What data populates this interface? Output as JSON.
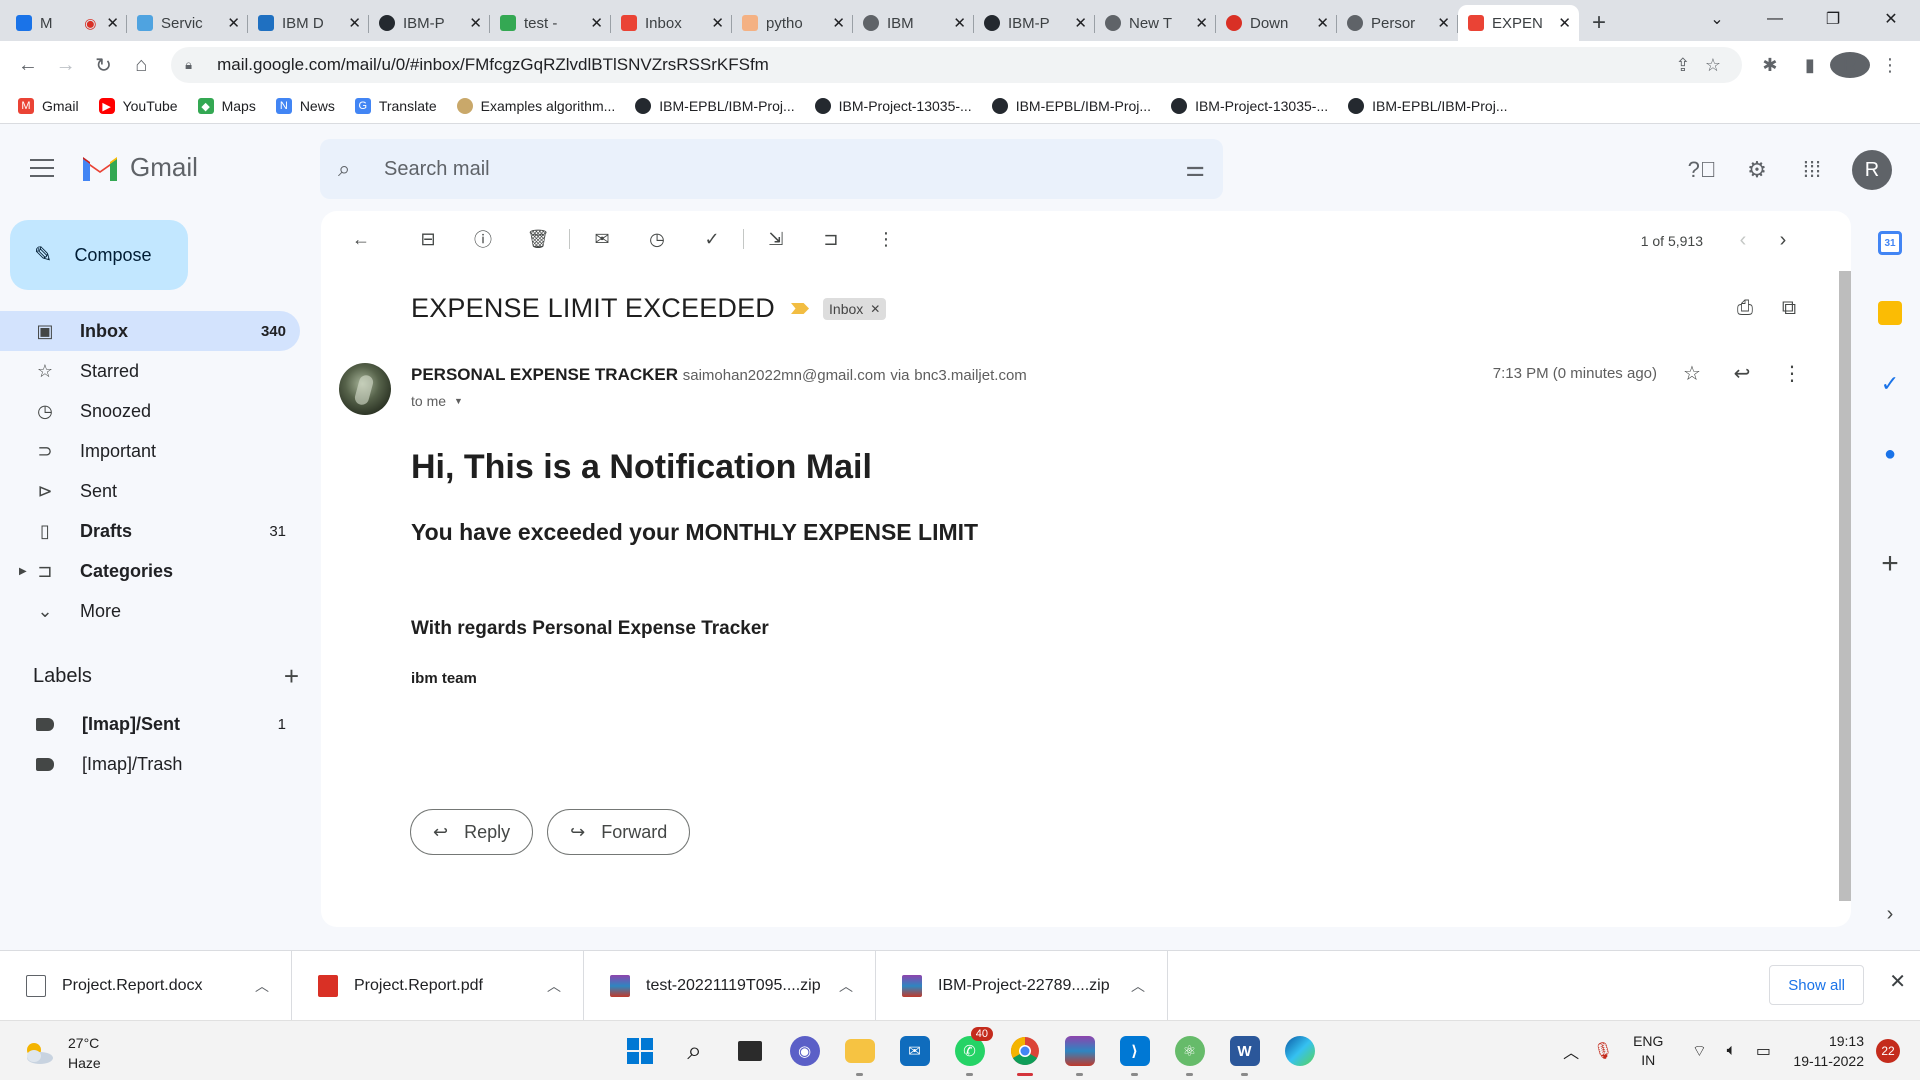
{
  "browser": {
    "tabs": [
      {
        "title": "M",
        "color": "#1a73e8"
      },
      {
        "title": "Servic",
        "color": "#4fa3e0"
      },
      {
        "title": "IBM D",
        "color": "#1f70c1"
      },
      {
        "title": "IBM-P",
        "color": "#24292f"
      },
      {
        "title": "test -",
        "color": "#34a853"
      },
      {
        "title": "Inbox",
        "color": "#ea4335"
      },
      {
        "title": "pytho",
        "color": "#f4b183"
      },
      {
        "title": "IBM",
        "color": "#5f6368"
      },
      {
        "title": "IBM-P",
        "color": "#24292f"
      },
      {
        "title": "New T",
        "color": "#5f6368"
      },
      {
        "title": "Down",
        "color": "#d93025"
      },
      {
        "title": "Persor",
        "color": "#5f6368"
      },
      {
        "title": "EXPEN",
        "color": "#ea4335"
      }
    ],
    "url": "mail.google.com/mail/u/0/#inbox/FMfcgzGqRZlvdlBTlSNVZrsRSSrKFSfm",
    "profile_initial": "R",
    "bookmarks": [
      {
        "label": "Gmail",
        "color": "#ea4335"
      },
      {
        "label": "YouTube",
        "color": "#ff0000"
      },
      {
        "label": "Maps",
        "color": "#34a853"
      },
      {
        "label": "News",
        "color": "#4285f4"
      },
      {
        "label": "Translate",
        "color": "#4285f4"
      },
      {
        "label": "Examples algorithm...",
        "color": "#c9a86a"
      },
      {
        "label": "IBM-EPBL/IBM-Proj...",
        "color": "#24292f"
      },
      {
        "label": "IBM-Project-13035-...",
        "color": "#24292f"
      },
      {
        "label": "IBM-EPBL/IBM-Proj...",
        "color": "#24292f"
      },
      {
        "label": "IBM-Project-13035-...",
        "color": "#24292f"
      },
      {
        "label": "IBM-EPBL/IBM-Proj...",
        "color": "#24292f"
      }
    ]
  },
  "gmail": {
    "brand": "Gmail",
    "search_placeholder": "Search mail",
    "avatar_initial": "R",
    "compose_label": "Compose",
    "nav": [
      {
        "label": "Inbox",
        "count": "340",
        "icon": "inbox-icon"
      },
      {
        "label": "Starred",
        "count": "",
        "icon": "star-icon"
      },
      {
        "label": "Snoozed",
        "count": "",
        "icon": "clock-icon"
      },
      {
        "label": "Important",
        "count": "",
        "icon": "important-icon"
      },
      {
        "label": "Sent",
        "count": "",
        "icon": "send-icon"
      },
      {
        "label": "Drafts",
        "count": "31",
        "icon": "draft-icon"
      },
      {
        "label": "Categories",
        "count": "",
        "icon": "label-icon"
      },
      {
        "label": "More",
        "count": "",
        "icon": "chevron-down-icon"
      }
    ],
    "labels_heading": "Labels",
    "labels": [
      {
        "label": "[Imap]/Sent",
        "count": "1"
      },
      {
        "label": "[Imap]/Trash",
        "count": ""
      }
    ],
    "pager": "1 of 5,913",
    "message": {
      "subject": "EXPENSE LIMIT EXCEEDED",
      "chip": "Inbox",
      "sender_name": "PERSONAL EXPENSE TRACKER",
      "sender_email": "saimohan2022mn@gmail.com",
      "via_word": "via",
      "via_domain": "bnc3.mailjet.com",
      "to": "to me",
      "time": "7:13 PM (0 minutes ago)",
      "heading": "Hi, This is a Notification Mail",
      "line1": "You have exceeded your MONTHLY EXPENSE LIMIT",
      "regards": "With regards Personal Expense Tracker",
      "team": "ibm team"
    },
    "reply_label": "Reply",
    "forward_label": "Forward"
  },
  "downloads": {
    "items": [
      {
        "name": "Project.Report.docx",
        "color": "#ffffff"
      },
      {
        "name": "Project.Report.pdf",
        "color": "#d93025"
      },
      {
        "name": "test-20221119T095....zip",
        "color": "#8e44ad"
      },
      {
        "name": "IBM-Project-22789....zip",
        "color": "#8e44ad"
      }
    ],
    "show_all": "Show all"
  },
  "taskbar": {
    "temp": "27°C",
    "condition": "Haze",
    "whatsapp_badge": "40",
    "lang_top": "ENG",
    "lang_bottom": "IN",
    "time": "19:13",
    "date": "19-11-2022",
    "notif_count": "22"
  }
}
